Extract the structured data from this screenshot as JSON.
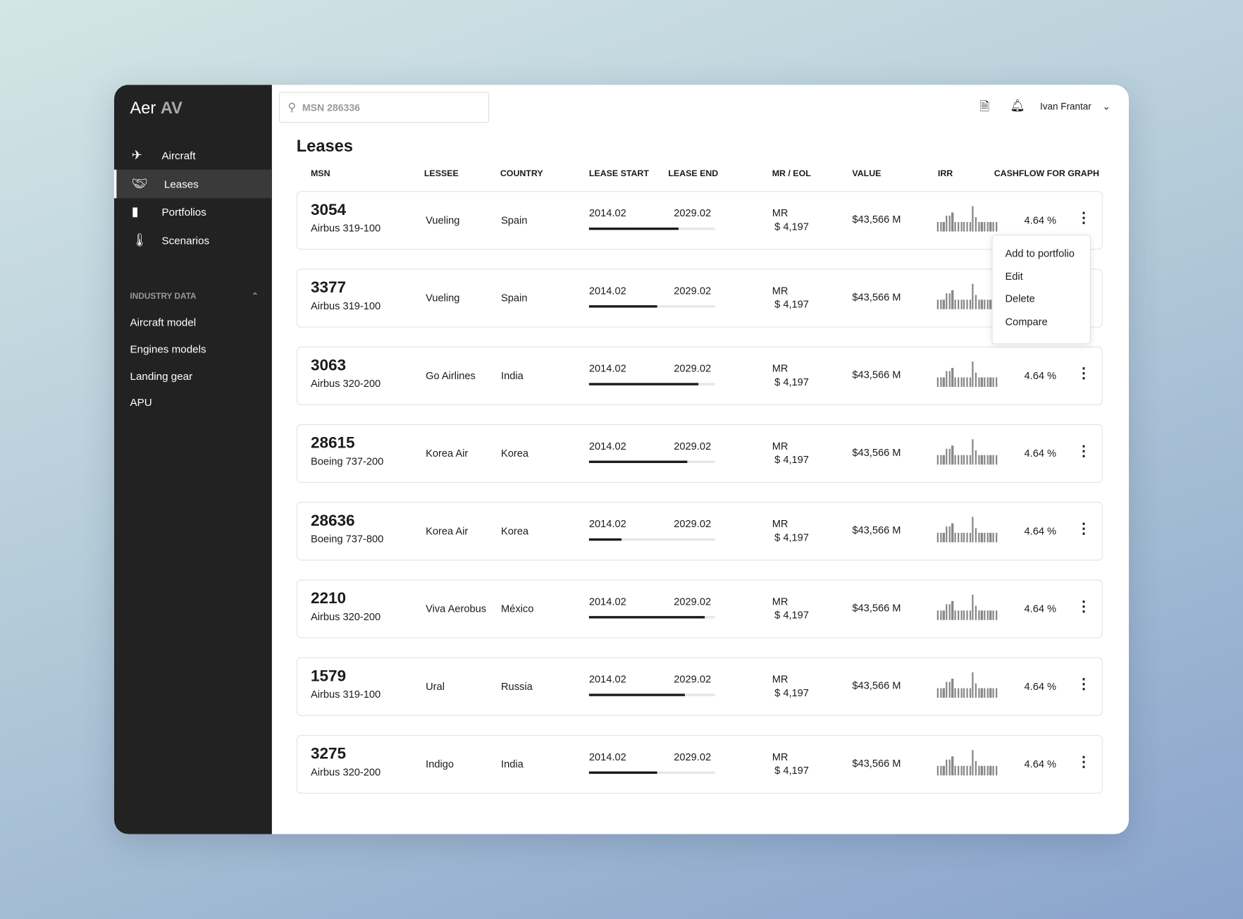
{
  "app": {
    "brand_light": "Aer",
    "brand_bold": "AV"
  },
  "sidebar": {
    "items": [
      {
        "label": "Aircraft",
        "icon": "airplane-icon"
      },
      {
        "label": "Leases",
        "icon": "handshake-icon",
        "active": true
      },
      {
        "label": "Portfolios",
        "icon": "briefcase-icon"
      },
      {
        "label": "Scenarios",
        "icon": "thermometer-icon"
      }
    ],
    "section": {
      "title": "INDUSTRY DATA",
      "items": [
        "Aircraft model",
        "Engines models",
        "Landing gear",
        "APU"
      ]
    }
  },
  "header": {
    "search_placeholder": "MSN 286336",
    "user": "Ivan Frantar"
  },
  "page_title": "Leases",
  "columns": [
    "MSN",
    "LESSEE",
    "COUNTRY",
    "LEASE START",
    "LEASE END",
    "MR / EOL",
    "VALUE",
    "IRR",
    "CASHFLOW FOR GRAPH"
  ],
  "cashflow_bars": [
    3,
    3,
    3,
    5,
    5,
    6,
    3,
    3,
    3,
    3,
    3,
    3,
    8,
    4.5,
    3,
    3,
    3,
    3,
    3,
    3,
    3
  ],
  "rows": [
    {
      "msn": "3054",
      "model": "Airbus 319-100",
      "lessee": "Vueling",
      "country": "Spain",
      "start": "2014.02",
      "end": "2029.02",
      "progress": 0.71,
      "mr": "MR",
      "mr_value": "$ 4,197",
      "value": "$43,566 M",
      "irr": "4.64 %"
    },
    {
      "msn": "3377",
      "model": "Airbus 319-100",
      "lessee": "Vueling",
      "country": "Spain",
      "start": "2014.02",
      "end": "2029.02",
      "progress": 0.54,
      "mr": "MR",
      "mr_value": "$ 4,197",
      "value": "$43,566 M",
      "irr": "4.64 %"
    },
    {
      "msn": "3063",
      "model": "Airbus 320-200",
      "lessee": "Go Airlines",
      "country": "India",
      "start": "2014.02",
      "end": "2029.02",
      "progress": 0.87,
      "mr": "MR",
      "mr_value": "$ 4,197",
      "value": "$43,566 M",
      "irr": "4.64 %"
    },
    {
      "msn": "28615",
      "model": "Boeing 737-200",
      "lessee": "Korea Air",
      "country": "Korea",
      "start": "2014.02",
      "end": "2029.02",
      "progress": 0.78,
      "mr": "MR",
      "mr_value": "$ 4,197",
      "value": "$43,566 M",
      "irr": "4.64 %"
    },
    {
      "msn": "28636",
      "model": "Boeing 737-800",
      "lessee": "Korea Air",
      "country": "Korea",
      "start": "2014.02",
      "end": "2029.02",
      "progress": 0.26,
      "mr": "MR",
      "mr_value": "$ 4,197",
      "value": "$43,566 M",
      "irr": "4.64 %"
    },
    {
      "msn": "2210",
      "model": "Airbus 320-200",
      "lessee": "Viva Aerobus",
      "country": "México",
      "start": "2014.02",
      "end": "2029.02",
      "progress": 0.92,
      "mr": "MR",
      "mr_value": "$ 4,197",
      "value": "$43,566 M",
      "irr": "4.64 %"
    },
    {
      "msn": "1579",
      "model": "Airbus 319-100",
      "lessee": "Ural",
      "country": "Russia",
      "start": "2014.02",
      "end": "2029.02",
      "progress": 0.76,
      "mr": "MR",
      "mr_value": "$ 4,197",
      "value": "$43,566 M",
      "irr": "4.64 %"
    },
    {
      "msn": "3275",
      "model": "Airbus 320-200",
      "lessee": "Indigo",
      "country": "India",
      "start": "2014.02",
      "end": "2029.02",
      "progress": 0.54,
      "mr": "MR",
      "mr_value": "$ 4,197",
      "value": "$43,566 M",
      "irr": "4.64 %"
    }
  ],
  "context_menu": [
    "Add to portfolio",
    "Edit",
    "Delete",
    "Compare"
  ]
}
